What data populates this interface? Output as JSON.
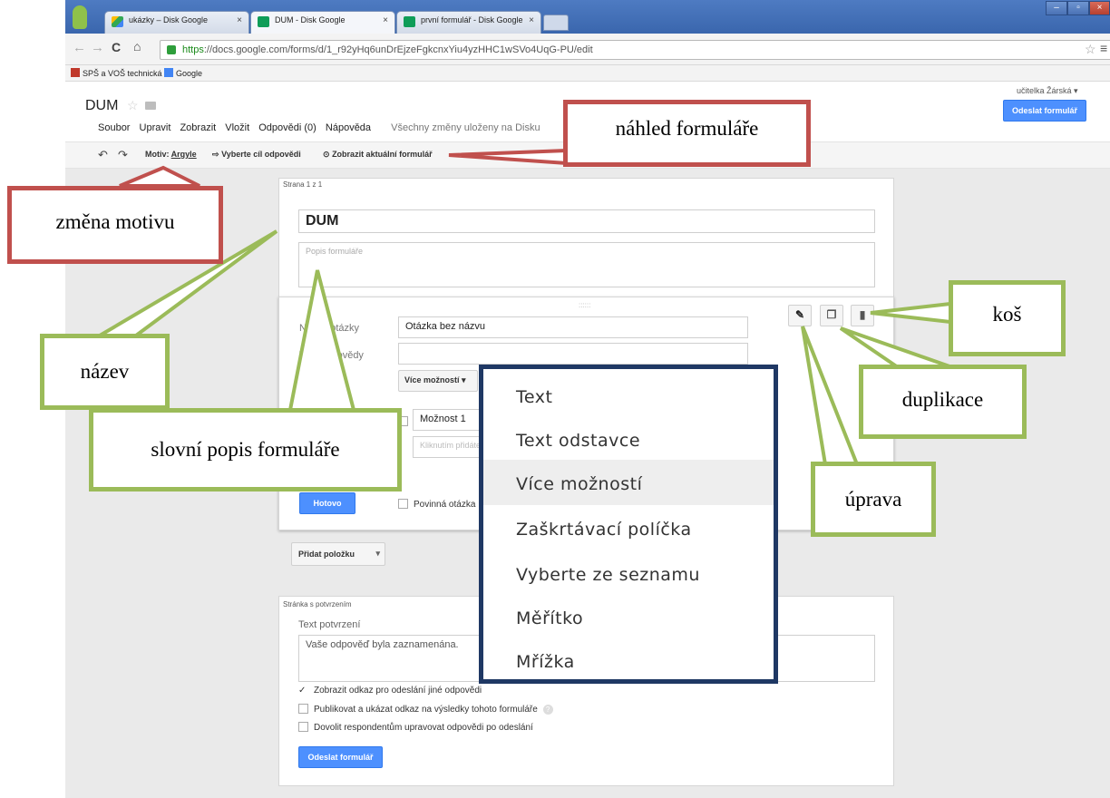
{
  "browser": {
    "tabs": [
      {
        "label": "ukázky – Disk Google"
      },
      {
        "label": "DUM - Disk Google"
      },
      {
        "label": "první formulář - Disk Google"
      }
    ],
    "url_https": "https",
    "url_rest": "://docs.google.com/forms/d/1_r92yHq6unDrEjzeFgkcnxYiu4yzHHC1wSVo4UqG-PU/edit",
    "bookmarks": [
      "SPŠ a VOŠ technická",
      "Google"
    ]
  },
  "app": {
    "doc_title": "DUM",
    "user": "učitelka Žárská ▾",
    "send_button": "Odeslat formulář",
    "menu": [
      "Soubor",
      "Upravit",
      "Zobrazit",
      "Vložit",
      "Odpovědi (0)",
      "Nápověda"
    ],
    "save_status": "Všechny změny uloženy na Disku",
    "toolbar": {
      "theme_label": "Motiv:",
      "theme_value": "Argyle",
      "destination": "Vyberte cíl odpovědi",
      "view_live": "Zobrazit aktuální formulář"
    }
  },
  "form": {
    "page_label": "Strana 1 z 1",
    "title": "DUM",
    "description_placeholder": "Popis formuláře",
    "question": {
      "title_label": "Název otázky",
      "title_value": "Otázka bez názvu",
      "help_label": "Text nápovědy",
      "type_value": "Více možností",
      "option1": "Možnost 1",
      "option_add_placeholder": "Kliknutím přidáte možnost",
      "done_button": "Hotovo",
      "required_label": "Povinná otázka"
    },
    "add_item_button": "Přidat položku",
    "confirmation": {
      "section_label": "Stránka s potvrzením",
      "text_label": "Text potvrzení",
      "text_value": "Vaše odpověď byla zaznamenána.",
      "checkboxes": [
        "Zobrazit odkaz pro odeslání jiné odpovědi",
        "Publikovat a ukázat odkaz na výsledky tohoto formuláře",
        "Dovolit respondentům upravovat odpovědi po odeslání"
      ],
      "send_button": "Odeslat formulář"
    }
  },
  "dropdown": {
    "items": [
      "Text",
      "Text odstavce",
      "Více možností",
      "Zaškrtávací políčka",
      "Vyberte ze seznamu",
      "Měřítko",
      "Mřížka"
    ],
    "selected": "Více možností"
  },
  "callouts": {
    "preview": "náhled formuláře",
    "theme": "změna motivu",
    "title": "název",
    "description": "slovní popis formuláře",
    "trash": "koš",
    "duplicate": "duplikace",
    "edit": "úprava"
  },
  "colors": {
    "red_callout": "#c0504d",
    "green_callout": "#9bbb59",
    "dropdown_border": "#1f3864",
    "accent_blue": "#4d90fe"
  }
}
